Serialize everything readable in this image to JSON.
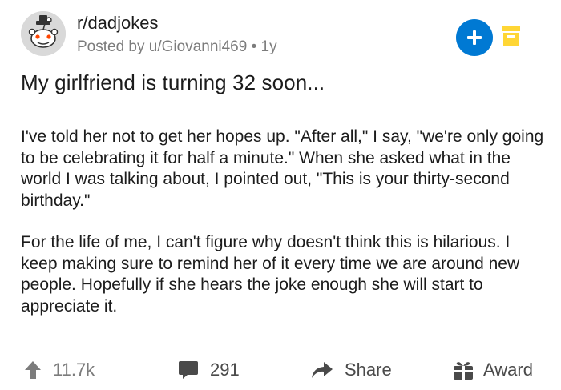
{
  "post": {
    "subreddit": "r/dadjokes",
    "posted_by": "Posted by u/Giovanni469 • 1y",
    "title": "My girlfriend is turning 32 soon...",
    "paragraphs": [
      "I've told her not to get her hopes up. \"After all,\" I say, \"we're only going to be celebrating it for half a minute.\" When she asked what in the world I was talking about, I pointed out, \"This is your thirty-second birthday.\"",
      "For the life of me, I can't figure why doesn't think this is hilarious. I keep making sure to remind her of it every time we are around new people. Hopefully if she hears the joke enough she will start to appreciate it."
    ]
  },
  "actions": {
    "votes": "11.7k",
    "comments": "291",
    "share": "Share",
    "award": "Award"
  },
  "icons": {
    "avatar": "snoo-avatar-icon",
    "join": "plus-icon",
    "save": "save-icon",
    "upvote": "upvote-arrow-icon",
    "comment": "comment-bubble-icon",
    "share": "share-arrow-icon",
    "award": "gift-award-icon"
  },
  "colors": {
    "join_button": "#0079d3",
    "save_icon": "#ffd635",
    "muted_text": "#7c7c7c",
    "action_text": "#4a4a4a",
    "avatar_bg": "#d9d9d9"
  }
}
